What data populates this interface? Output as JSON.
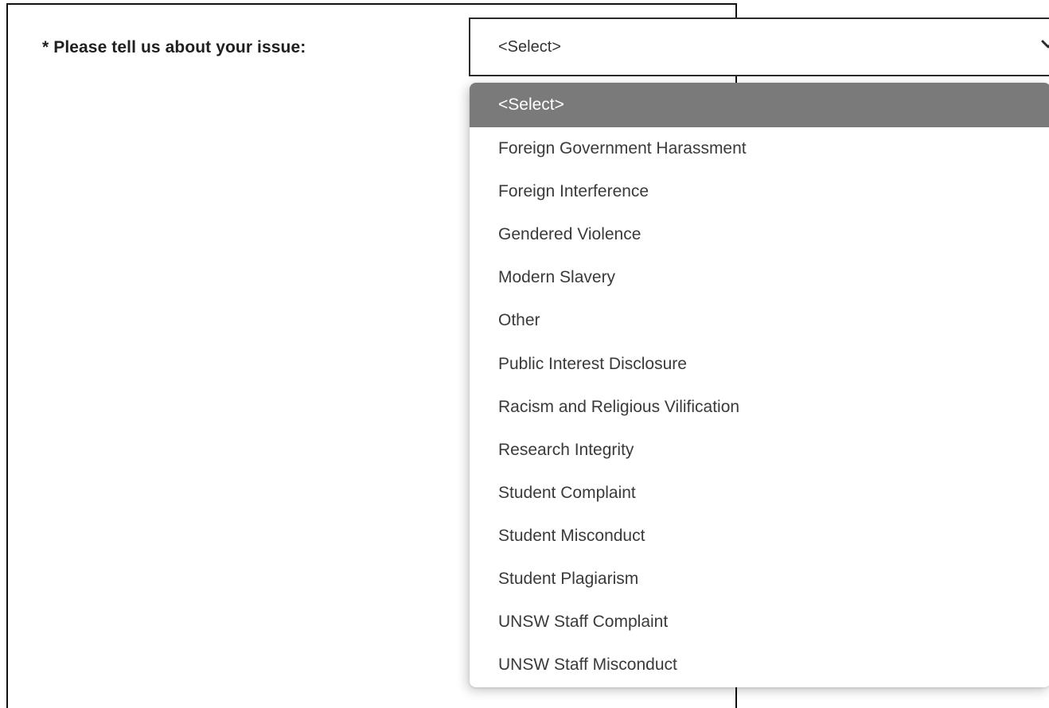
{
  "form": {
    "issue_label": "* Please tell us about your issue:",
    "issue_select": {
      "selected_value": "<Select>",
      "chevron_icon": "chevron-down-icon",
      "options": [
        "<Select>",
        "Foreign Government Harassment",
        "Foreign Interference",
        "Gendered Violence",
        "Modern Slavery",
        "Other",
        "Public Interest Disclosure",
        "Racism and Religious Vilification",
        "Research Integrity",
        "Student Complaint",
        "Student Misconduct",
        "Student Plagiarism",
        "UNSW Staff Complaint",
        "UNSW Staff Misconduct"
      ],
      "highlighted_index": 0
    }
  },
  "colors": {
    "highlight_background": "#7a7a7a",
    "highlight_text": "#ffffff",
    "option_text": "#3a3a3a",
    "label_text": "#1f1f1f"
  }
}
